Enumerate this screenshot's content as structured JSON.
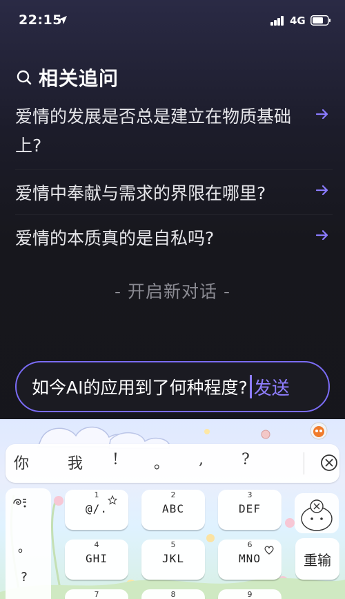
{
  "status_bar": {
    "time": "22:15",
    "network": "4G"
  },
  "related": {
    "title": "相关追问",
    "questions": [
      {
        "text": "爱情的发展是否总是建立在物质基础上?"
      },
      {
        "text": "爱情中奉献与需求的界限在哪里?"
      },
      {
        "text": "爱情的本质真的是自私吗?"
      }
    ]
  },
  "new_chat": "- 开启新对话 -",
  "input": {
    "value": "如今AI的应用到了何种程度?",
    "send_label": "发送"
  },
  "keyboard": {
    "candidates": [
      "你",
      "我",
      "!",
      "。",
      ",",
      "?"
    ],
    "side_keys": [
      "?",
      "?"
    ],
    "keys": [
      {
        "num": "1",
        "label": "@/."
      },
      {
        "num": "2",
        "label": "ABC"
      },
      {
        "num": "3",
        "label": "DEF"
      },
      {
        "num": "4",
        "label": "GHI"
      },
      {
        "num": "5",
        "label": "JKL"
      },
      {
        "num": "6",
        "label": "MNO"
      },
      {
        "num": "7",
        "label": ""
      },
      {
        "num": "8",
        "label": ""
      },
      {
        "num": "9",
        "label": ""
      }
    ],
    "reinput_label": "重输"
  },
  "colors": {
    "accent": "#7b6cf6",
    "background": "#17171d",
    "text": "#e6e6ea",
    "muted": "#8b8b93"
  }
}
